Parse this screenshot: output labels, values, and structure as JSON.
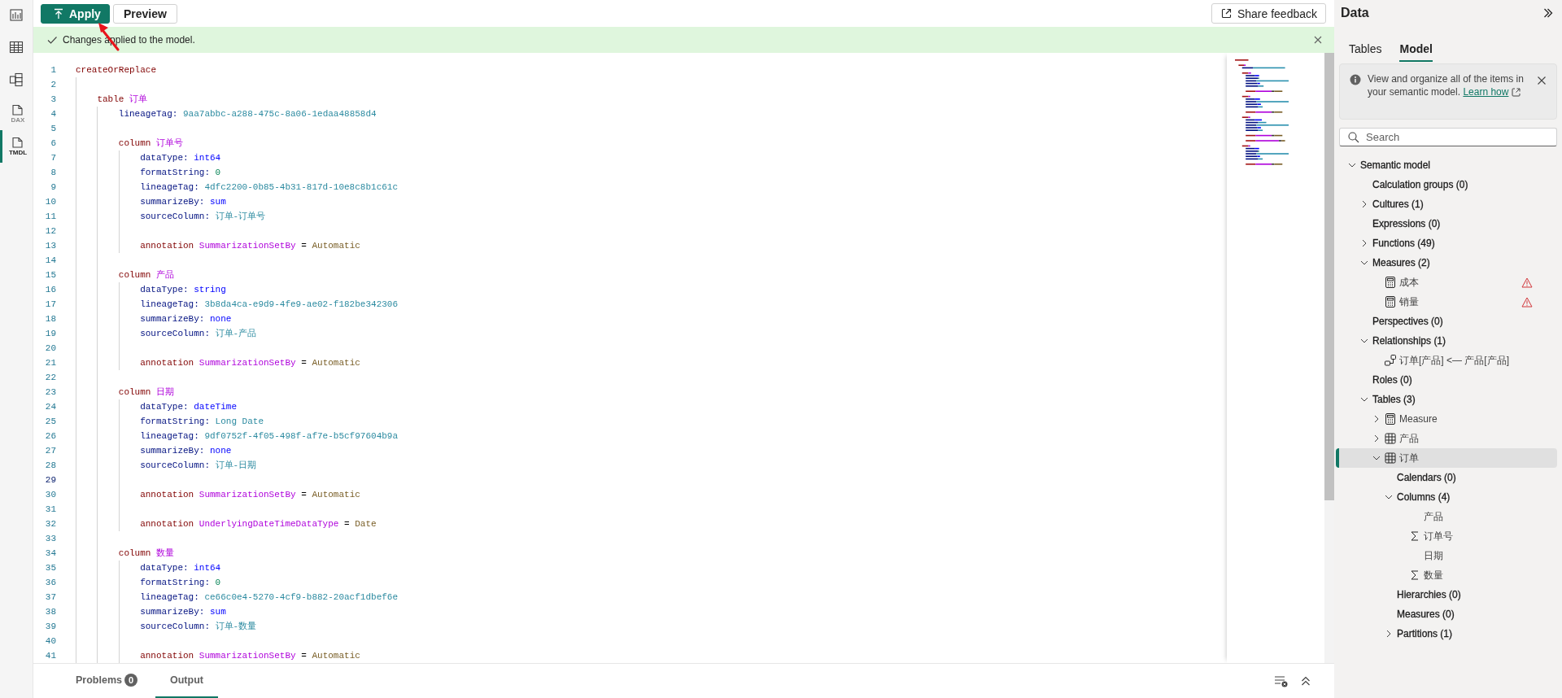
{
  "nav_rail": [
    {
      "kind": "report",
      "selected": false
    },
    {
      "kind": "table",
      "selected": false
    },
    {
      "kind": "model",
      "selected": false
    },
    {
      "kind": "dax",
      "label": "DAX",
      "selected": false
    },
    {
      "kind": "tmdl",
      "label": "TMDL",
      "selected": true
    }
  ],
  "toolbar": {
    "buttons": [
      {
        "label": "Apply",
        "kind": "primary"
      },
      {
        "label": "Preview",
        "kind": "secondary"
      }
    ],
    "feedback_button": "Share feedback"
  },
  "banner": {
    "message": "Changes applied to the model."
  },
  "editor": {
    "lines": [
      {
        "n": "1",
        "current": false,
        "tk": [
          {
            "kind": "keyword",
            "text": "createOrReplace"
          }
        ],
        "children": [
          {
            "n": "2",
            "current": false
          },
          {
            "n": "3",
            "current": false,
            "tk": [
              {
                "kind": "keyword",
                "text": "table "
              },
              {
                "kind": "name",
                "text": "订单"
              }
            ],
            "children": [
              {
                "n": "4",
                "current": false,
                "tk": [
                  {
                    "kind": "property",
                    "text": "lineageTag: "
                  },
                  {
                    "kind": "string",
                    "text": "9aa7abbc-a288-475c-8a06-1edaa48858d4"
                  }
                ]
              },
              {
                "n": "5",
                "current": false
              },
              {
                "n": "6",
                "current": false,
                "tk": [
                  {
                    "kind": "keyword",
                    "text": "column "
                  },
                  {
                    "kind": "name",
                    "text": "订单号"
                  }
                ],
                "children": [
                  {
                    "n": "7",
                    "current": false,
                    "tk": [
                      {
                        "kind": "property",
                        "text": "dataType: "
                      },
                      {
                        "kind": "enum",
                        "text": "int64"
                      }
                    ]
                  },
                  {
                    "n": "8",
                    "current": false,
                    "tk": [
                      {
                        "kind": "property",
                        "text": "formatString: "
                      },
                      {
                        "kind": "number",
                        "text": "0"
                      }
                    ]
                  },
                  {
                    "n": "9",
                    "current": false,
                    "tk": [
                      {
                        "kind": "property",
                        "text": "lineageTag: "
                      },
                      {
                        "kind": "string",
                        "text": "4dfc2200-0b85-4b31-817d-10e8c8b1c61c"
                      }
                    ]
                  },
                  {
                    "n": "10",
                    "current": false,
                    "tk": [
                      {
                        "kind": "property",
                        "text": "summarizeBy: "
                      },
                      {
                        "kind": "enum",
                        "text": "sum"
                      }
                    ]
                  },
                  {
                    "n": "11",
                    "current": false,
                    "tk": [
                      {
                        "kind": "property",
                        "text": "sourceColumn: "
                      },
                      {
                        "kind": "string",
                        "text": "订单-订单号"
                      }
                    ]
                  },
                  {
                    "n": "12",
                    "current": false
                  },
                  {
                    "n": "13",
                    "current": false,
                    "tk": [
                      {
                        "kind": "keyword",
                        "text": "annotation "
                      },
                      {
                        "kind": "name",
                        "text": "SummarizationSetBy"
                      },
                      {
                        "kind": "operator",
                        "text": " = "
                      },
                      {
                        "kind": "value",
                        "text": "Automatic"
                      }
                    ]
                  }
                ]
              },
              {
                "n": "14",
                "current": false
              },
              {
                "n": "15",
                "current": false,
                "tk": [
                  {
                    "kind": "keyword",
                    "text": "column "
                  },
                  {
                    "kind": "name",
                    "text": "产品"
                  }
                ],
                "children": [
                  {
                    "n": "16",
                    "current": false,
                    "tk": [
                      {
                        "kind": "property",
                        "text": "dataType: "
                      },
                      {
                        "kind": "enum",
                        "text": "string"
                      }
                    ]
                  },
                  {
                    "n": "17",
                    "current": false,
                    "tk": [
                      {
                        "kind": "property",
                        "text": "lineageTag: "
                      },
                      {
                        "kind": "string",
                        "text": "3b8da4ca-e9d9-4fe9-ae02-f182be342306"
                      }
                    ]
                  },
                  {
                    "n": "18",
                    "current": false,
                    "tk": [
                      {
                        "kind": "property",
                        "text": "summarizeBy: "
                      },
                      {
                        "kind": "enum",
                        "text": "none"
                      }
                    ]
                  },
                  {
                    "n": "19",
                    "current": false,
                    "tk": [
                      {
                        "kind": "property",
                        "text": "sourceColumn: "
                      },
                      {
                        "kind": "string",
                        "text": "订单-产品"
                      }
                    ]
                  },
                  {
                    "n": "20",
                    "current": false
                  },
                  {
                    "n": "21",
                    "current": false,
                    "tk": [
                      {
                        "kind": "keyword",
                        "text": "annotation "
                      },
                      {
                        "kind": "name",
                        "text": "SummarizationSetBy"
                      },
                      {
                        "kind": "operator",
                        "text": " = "
                      },
                      {
                        "kind": "value",
                        "text": "Automatic"
                      }
                    ]
                  }
                ]
              },
              {
                "n": "22",
                "current": false
              },
              {
                "n": "23",
                "current": false,
                "tk": [
                  {
                    "kind": "keyword",
                    "text": "column "
                  },
                  {
                    "kind": "name",
                    "text": "日期"
                  }
                ],
                "children": [
                  {
                    "n": "24",
                    "current": false,
                    "tk": [
                      {
                        "kind": "property",
                        "text": "dataType: "
                      },
                      {
                        "kind": "enum",
                        "text": "dateTime"
                      }
                    ]
                  },
                  {
                    "n": "25",
                    "current": false,
                    "tk": [
                      {
                        "kind": "property",
                        "text": "formatString: "
                      },
                      {
                        "kind": "string",
                        "text": "Long Date"
                      }
                    ]
                  },
                  {
                    "n": "26",
                    "current": false,
                    "tk": [
                      {
                        "kind": "property",
                        "text": "lineageTag: "
                      },
                      {
                        "kind": "string",
                        "text": "9df0752f-4f05-498f-af7e-b5cf97604b9a"
                      }
                    ]
                  },
                  {
                    "n": "27",
                    "current": false,
                    "tk": [
                      {
                        "kind": "property",
                        "text": "summarizeBy: "
                      },
                      {
                        "kind": "enum",
                        "text": "none"
                      }
                    ]
                  },
                  {
                    "n": "28",
                    "current": false,
                    "tk": [
                      {
                        "kind": "property",
                        "text": "sourceColumn: "
                      },
                      {
                        "kind": "string",
                        "text": "订单-日期"
                      }
                    ]
                  },
                  {
                    "n": "29",
                    "current": true
                  },
                  {
                    "n": "30",
                    "current": false,
                    "tk": [
                      {
                        "kind": "keyword",
                        "text": "annotation "
                      },
                      {
                        "kind": "name",
                        "text": "SummarizationSetBy"
                      },
                      {
                        "kind": "operator",
                        "text": " = "
                      },
                      {
                        "kind": "value",
                        "text": "Automatic"
                      }
                    ]
                  },
                  {
                    "n": "31",
                    "current": false
                  },
                  {
                    "n": "32",
                    "current": false,
                    "tk": [
                      {
                        "kind": "keyword",
                        "text": "annotation "
                      },
                      {
                        "kind": "name",
                        "text": "UnderlyingDateTimeDataType"
                      },
                      {
                        "kind": "operator",
                        "text": " = "
                      },
                      {
                        "kind": "value",
                        "text": "Date"
                      }
                    ]
                  }
                ]
              },
              {
                "n": "33",
                "current": false
              },
              {
                "n": "34",
                "current": false,
                "tk": [
                  {
                    "kind": "keyword",
                    "text": "column "
                  },
                  {
                    "kind": "name",
                    "text": "数量"
                  }
                ],
                "children": [
                  {
                    "n": "35",
                    "current": false,
                    "tk": [
                      {
                        "kind": "property",
                        "text": "dataType: "
                      },
                      {
                        "kind": "enum",
                        "text": "int64"
                      }
                    ]
                  },
                  {
                    "n": "36",
                    "current": false,
                    "tk": [
                      {
                        "kind": "property",
                        "text": "formatString: "
                      },
                      {
                        "kind": "number",
                        "text": "0"
                      }
                    ]
                  },
                  {
                    "n": "37",
                    "current": false,
                    "tk": [
                      {
                        "kind": "property",
                        "text": "lineageTag: "
                      },
                      {
                        "kind": "string",
                        "text": "ce66c0e4-5270-4cf9-b882-20acf1dbef6e"
                      }
                    ]
                  },
                  {
                    "n": "38",
                    "current": false,
                    "tk": [
                      {
                        "kind": "property",
                        "text": "summarizeBy: "
                      },
                      {
                        "kind": "enum",
                        "text": "sum"
                      }
                    ]
                  },
                  {
                    "n": "39",
                    "current": false,
                    "tk": [
                      {
                        "kind": "property",
                        "text": "sourceColumn: "
                      },
                      {
                        "kind": "string",
                        "text": "订单-数量"
                      }
                    ]
                  },
                  {
                    "n": "40",
                    "current": false
                  },
                  {
                    "n": "41",
                    "current": false,
                    "tk": [
                      {
                        "kind": "keyword",
                        "text": "annotation "
                      },
                      {
                        "kind": "name",
                        "text": "SummarizationSetBy"
                      },
                      {
                        "kind": "operator",
                        "text": " = "
                      },
                      {
                        "kind": "value",
                        "text": "Automatic"
                      }
                    ]
                  }
                ]
              }
            ]
          }
        ]
      }
    ]
  },
  "bottom_panel": {
    "tabs": [
      {
        "label": "Problems",
        "badge": "0",
        "selected": false
      },
      {
        "label": "Output",
        "selected": true
      }
    ]
  },
  "data_pane": {
    "title": "Data",
    "tabs": [
      {
        "label": "Tables",
        "selected": false
      },
      {
        "label": "Model",
        "selected": true
      }
    ],
    "info": {
      "text": "View and organize all of the items in your semantic model.",
      "link": "Learn how"
    },
    "search": {
      "placeholder": "Search"
    },
    "tree": [
      {
        "label": "Semantic model",
        "kind": "folder",
        "expanded": true,
        "selected": false,
        "children": [
          {
            "label": "Calculation groups (0)",
            "kind": "folder",
            "selected": false
          },
          {
            "label": "Cultures (1)",
            "kind": "folder",
            "expanded": false,
            "selected": false
          },
          {
            "label": "Expressions (0)",
            "kind": "folder",
            "selected": false
          },
          {
            "label": "Functions (49)",
            "kind": "folder",
            "expanded": false,
            "selected": false
          },
          {
            "label": "Measures (2)",
            "kind": "folder",
            "expanded": true,
            "selected": false,
            "children": [
              {
                "label": "成本",
                "kind": "measure",
                "warning": true,
                "selected": false
              },
              {
                "label": "销量",
                "kind": "measure",
                "warning": true,
                "selected": false
              }
            ]
          },
          {
            "label": "Perspectives (0)",
            "kind": "folder",
            "selected": false
          },
          {
            "label": "Relationships (1)",
            "kind": "folder",
            "expanded": true,
            "selected": false,
            "children": [
              {
                "label": "订单[产品] <— 产品[产品]",
                "kind": "relationship",
                "selected": false
              }
            ]
          },
          {
            "label": "Roles (0)",
            "kind": "folder",
            "selected": false
          },
          {
            "label": "Tables (3)",
            "kind": "folder",
            "expanded": true,
            "selected": false,
            "children": [
              {
                "label": "Measure",
                "kind": "measure-table",
                "expanded": false,
                "selected": false
              },
              {
                "label": "产品",
                "kind": "table",
                "expanded": false,
                "selected": false
              },
              {
                "label": "订单",
                "kind": "table",
                "expanded": true,
                "selected": true,
                "children": [
                  {
                    "label": "Calendars (0)",
                    "kind": "folder",
                    "selected": false
                  },
                  {
                    "label": "Columns (4)",
                    "kind": "folder",
                    "expanded": true,
                    "selected": false,
                    "children": [
                      {
                        "label": "产品",
                        "kind": "column",
                        "selected": false
                      },
                      {
                        "label": "订单号",
                        "kind": "numeric-column",
                        "selected": false
                      },
                      {
                        "label": "日期",
                        "kind": "column",
                        "selected": false
                      },
                      {
                        "label": "数量",
                        "kind": "numeric-column",
                        "selected": false
                      }
                    ]
                  },
                  {
                    "label": "Hierarchies (0)",
                    "kind": "folder",
                    "selected": false
                  },
                  {
                    "label": "Measures (0)",
                    "kind": "folder",
                    "selected": false
                  },
                  {
                    "label": "Partitions (1)",
                    "kind": "folder",
                    "expanded": false,
                    "selected": false
                  }
                ]
              }
            ]
          }
        ]
      }
    ]
  }
}
